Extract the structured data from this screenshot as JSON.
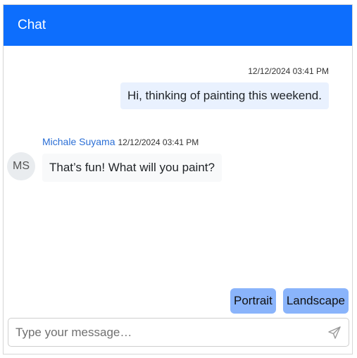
{
  "header": {
    "title": "Chat"
  },
  "messages": [
    {
      "direction": "outgoing",
      "time": "12/12/2024 03:41 PM",
      "text": "Hi, thinking of painting this weekend."
    },
    {
      "direction": "incoming",
      "sender": "Michale Suyama",
      "avatar_initials": "MS",
      "time": "12/12/2024 03:41 PM",
      "text": "That’s fun! What will you paint?"
    }
  ],
  "suggestions": [
    "Portrait",
    "Landscape"
  ],
  "composer": {
    "placeholder": "Type your message…",
    "value": "",
    "send_icon": "send-icon"
  },
  "colors": {
    "header_bg": "#0d6efd",
    "outgoing_bubble": "#e9f1fe",
    "incoming_bubble": "#f8f9fa",
    "suggestion_bg": "#8ab4fb",
    "sender_name": "#2b6fd6"
  }
}
